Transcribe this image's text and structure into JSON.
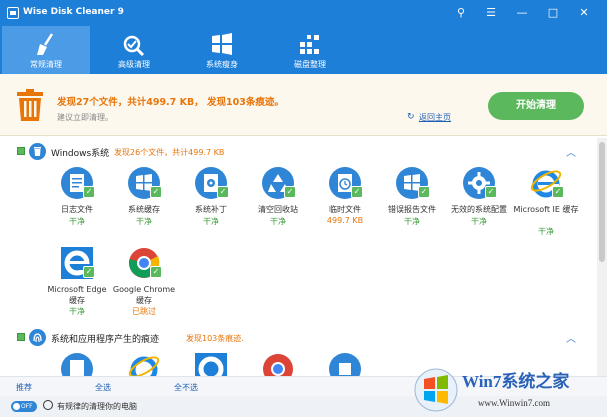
{
  "window": {
    "title": "Wise Disk Cleaner 9",
    "controls": [
      "⚲",
      "☰",
      "—",
      "□",
      "✕"
    ]
  },
  "toolbar": {
    "tabs": [
      {
        "label": "常规清理",
        "icon": "broom-icon"
      },
      {
        "label": "高级清理",
        "icon": "scan-icon"
      },
      {
        "label": "系统瘦身",
        "icon": "windows-icon"
      },
      {
        "label": "磁盘整理",
        "icon": "defrag-icon"
      }
    ]
  },
  "summary": {
    "main": "发现27个文件，共计499.7 KB， 发现103条痕迹。",
    "sub": "建议立即清理。",
    "back_home": "返回主页",
    "start_button": "开始清理"
  },
  "categories": [
    {
      "title": "Windows系统",
      "stat": "发现26个文件，共计499.7 KB",
      "items": [
        {
          "name": "日志文件",
          "state": "干净",
          "state_color": "green"
        },
        {
          "name": "系统缓存",
          "state": "干净",
          "state_color": "green"
        },
        {
          "name": "系统补丁",
          "state": "干净",
          "state_color": "green"
        },
        {
          "name": "清空回收站",
          "state": "干净",
          "state_color": "green"
        },
        {
          "name": "临时文件",
          "state": "499.7 KB",
          "state_color": "orange"
        },
        {
          "name": "错误报告文件",
          "state": "干净",
          "state_color": "green"
        },
        {
          "name": "无效的系统配置",
          "state": "干净",
          "state_color": "green"
        },
        {
          "name": "Microsoft IE 缓存",
          "state": "干净",
          "state_color": "green"
        },
        {
          "name": "Microsoft Edge 缓存",
          "state": "干净",
          "state_color": "green"
        },
        {
          "name": "Google Chrome缓存",
          "state": "已跳过",
          "state_color": "orange"
        }
      ]
    },
    {
      "title": "系统和应用程序产生的痕迹",
      "stat": "发现103条痕迹."
    }
  ],
  "footer": {
    "recommend": "推荐",
    "select_all": "全选",
    "select_none": "全不选",
    "toggle": "OFF",
    "schedule_text": "有规律的清理你的电脑"
  },
  "watermark": {
    "text": "Win7系统之家",
    "url": "www.Winwin7.com"
  },
  "colors": {
    "titlebar": "#1e7fd9",
    "accent_orange": "#e8750a",
    "clean_green": "#3a9a3a",
    "start_button": "#5cb85c"
  }
}
